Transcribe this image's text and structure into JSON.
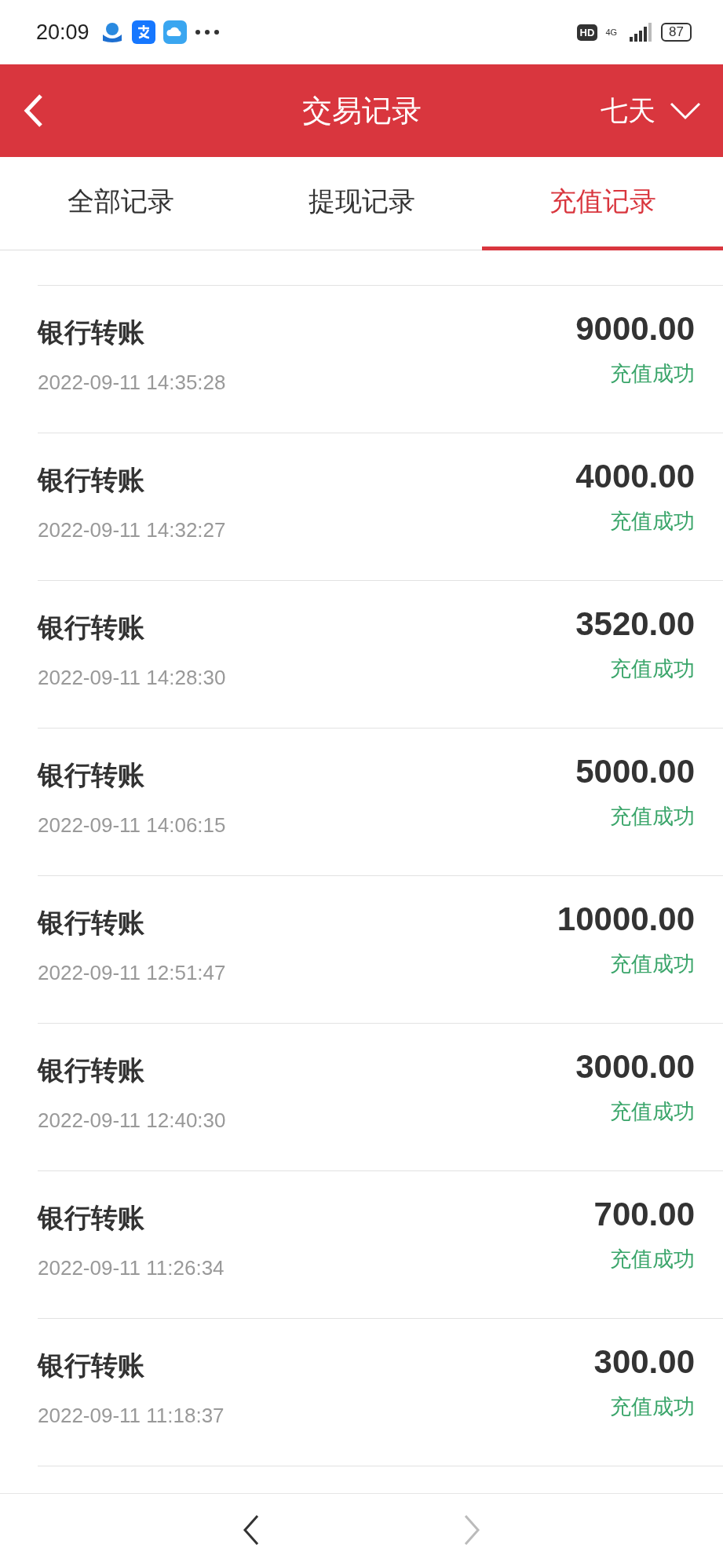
{
  "status_bar": {
    "time": "20:09",
    "hd": "HD",
    "network": "4G",
    "battery": "87"
  },
  "header": {
    "title": "交易记录",
    "period": "七天"
  },
  "tabs": [
    {
      "label": "全部记录",
      "selected": false
    },
    {
      "label": "提现记录",
      "selected": false
    },
    {
      "label": "充值记录",
      "selected": true
    }
  ],
  "records": [
    {
      "title": "银行转账",
      "time": "2022-09-11 14:35:28",
      "amount": "9000.00",
      "status": "充值成功"
    },
    {
      "title": "银行转账",
      "time": "2022-09-11 14:32:27",
      "amount": "4000.00",
      "status": "充值成功"
    },
    {
      "title": "银行转账",
      "time": "2022-09-11 14:28:30",
      "amount": "3520.00",
      "status": "充值成功"
    },
    {
      "title": "银行转账",
      "time": "2022-09-11 14:06:15",
      "amount": "5000.00",
      "status": "充值成功"
    },
    {
      "title": "银行转账",
      "time": "2022-09-11 12:51:47",
      "amount": "10000.00",
      "status": "充值成功"
    },
    {
      "title": "银行转账",
      "time": "2022-09-11 12:40:30",
      "amount": "3000.00",
      "status": "充值成功"
    },
    {
      "title": "银行转账",
      "time": "2022-09-11 11:26:34",
      "amount": "700.00",
      "status": "充值成功"
    },
    {
      "title": "银行转账",
      "time": "2022-09-11 11:18:37",
      "amount": "300.00",
      "status": "充值成功"
    }
  ]
}
